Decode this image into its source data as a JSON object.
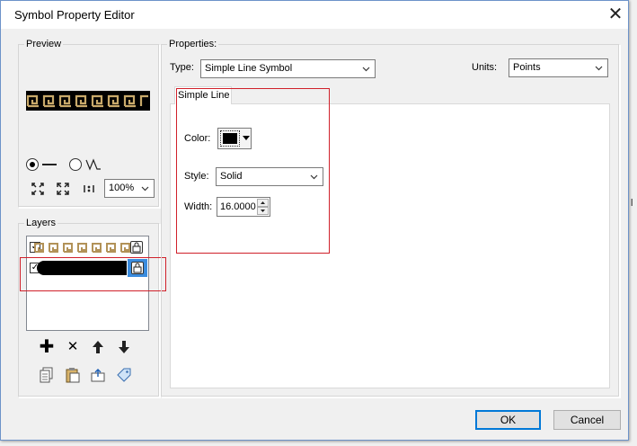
{
  "dialog": {
    "title": "Symbol Property Editor"
  },
  "preview": {
    "group_label": "Preview",
    "zoom_value": "100%"
  },
  "layers": {
    "group_label": "Layers"
  },
  "properties": {
    "group_label": "Properties:",
    "type_label": "Type:",
    "type_value": "Simple Line Symbol",
    "units_label": "Units:",
    "units_value": "Points",
    "tab_label": "Simple Line",
    "color_label": "Color:",
    "color_value": "#000000",
    "style_label": "Style:",
    "style_value": "Solid",
    "width_label": "Width:",
    "width_value": "16.0000"
  },
  "buttons": {
    "ok": "OK",
    "cancel": "Cancel"
  }
}
